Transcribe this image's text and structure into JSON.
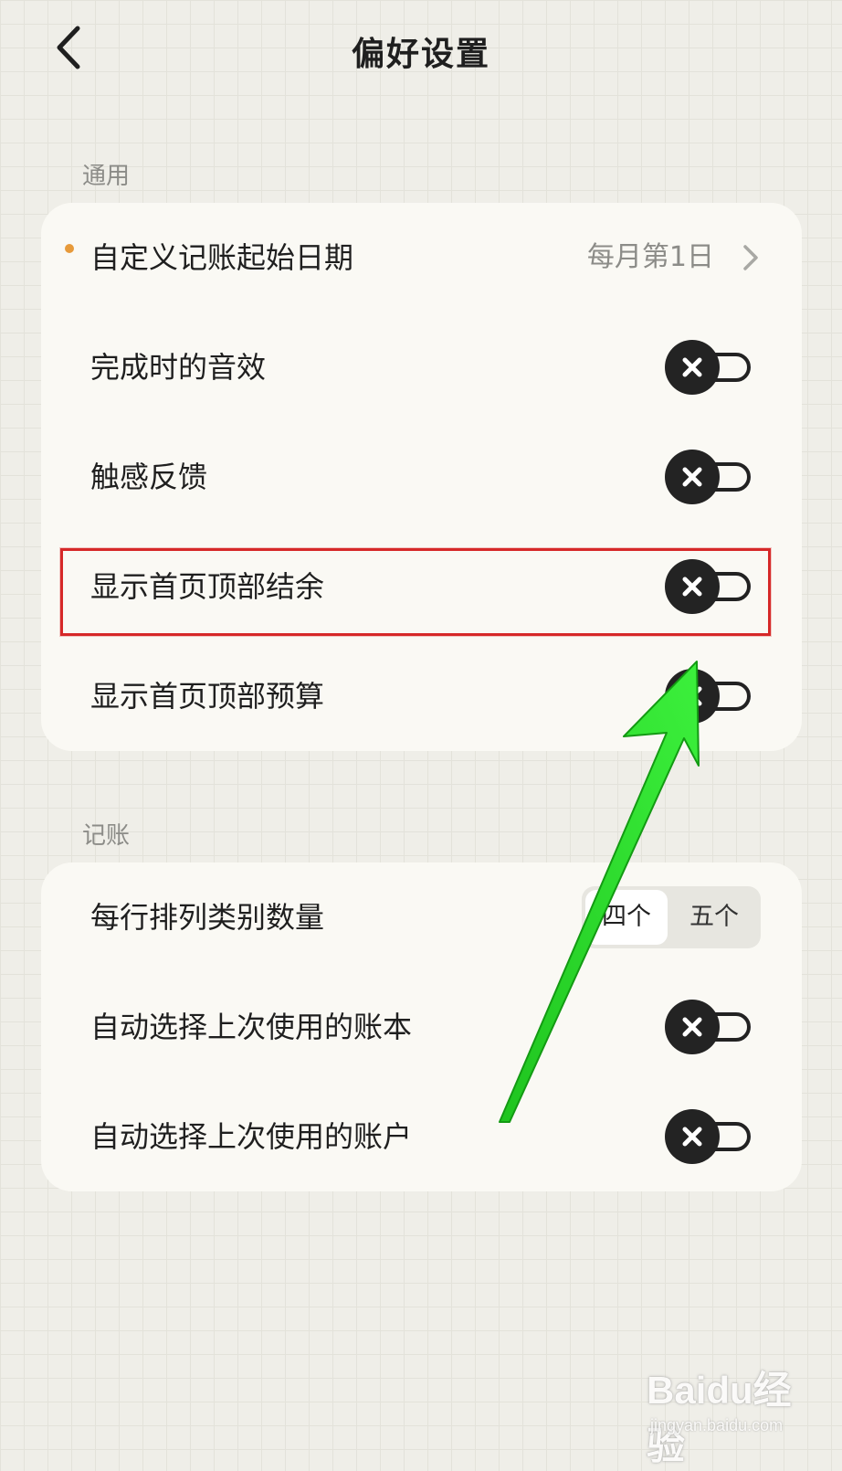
{
  "header": {
    "title": "偏好设置"
  },
  "sections": [
    {
      "label": "通用",
      "items": [
        {
          "label": "自定义记账起始日期",
          "value": "每月第1日",
          "has_dot": true,
          "control": "chevron"
        },
        {
          "label": "完成时的音效",
          "control": "toggle",
          "on": false
        },
        {
          "label": "触感反馈",
          "control": "toggle",
          "on": false
        },
        {
          "label": "显示首页顶部结余",
          "control": "toggle",
          "on": false,
          "highlighted": true
        },
        {
          "label": "显示首页顶部预算",
          "control": "toggle",
          "on": false
        }
      ]
    },
    {
      "label": "记账",
      "items": [
        {
          "label": "每行排列类别数量",
          "control": "segmented",
          "options": [
            "四个",
            "五个"
          ],
          "selected": "四个"
        },
        {
          "label": "自动选择上次使用的账本",
          "control": "toggle",
          "on": false
        },
        {
          "label": "自动选择上次使用的账户",
          "control": "toggle",
          "on": false
        }
      ]
    }
  ],
  "watermark": {
    "logo": "Baidu经验",
    "url": "jingyan.baidu.com"
  },
  "colors": {
    "highlight": "#d62828",
    "arrow": "#2bd42b",
    "dot": "#e79a3a"
  }
}
